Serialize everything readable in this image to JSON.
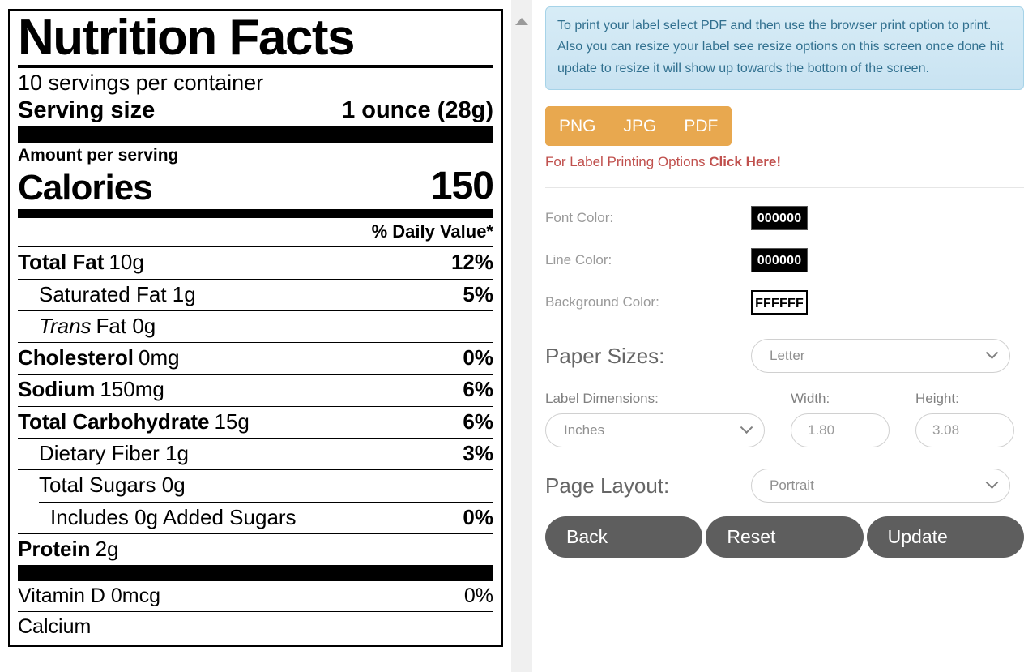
{
  "nutrition_label": {
    "title": "Nutrition Facts",
    "servings_per_container": "10 servings per container",
    "serving_size_label": "Serving size",
    "serving_size_value": "1 ounce (28g)",
    "amount_per_serving": "Amount per serving",
    "calories_label": "Calories",
    "calories_value": "150",
    "daily_value_header": "% Daily Value*",
    "rows": [
      {
        "name_bold": "Total Fat",
        "name_rest": "10g",
        "dv": "12%"
      },
      {
        "name_bold": "",
        "name_rest": "Saturated Fat 1g",
        "dv": "5%"
      },
      {
        "name_italic": "Trans",
        "name_rest": "Fat 0g",
        "dv": ""
      },
      {
        "name_bold": "Cholesterol",
        "name_rest": "0mg",
        "dv": "0%"
      },
      {
        "name_bold": "Sodium",
        "name_rest": "150mg",
        "dv": "6%"
      },
      {
        "name_bold": "Total Carbohydrate",
        "name_rest": "15g",
        "dv": "6%"
      },
      {
        "name_bold": "",
        "name_rest": "Dietary Fiber 1g",
        "dv": "3%"
      },
      {
        "name_bold": "",
        "name_rest": "Total Sugars 0g",
        "dv": ""
      },
      {
        "name_bold": "",
        "name_rest": "Includes 0g Added Sugars",
        "dv": "0%"
      },
      {
        "name_bold": "Protein",
        "name_rest": "2g",
        "dv": ""
      }
    ],
    "vitamins": [
      {
        "name": "Vitamin D  0mcg",
        "dv": "0%"
      },
      {
        "name": "Calcium",
        "dv": ""
      }
    ]
  },
  "options": {
    "info_text": "To print your label select PDF and then use the browser print option to print. Also you can resize your label see resize options on this screen once done hit update to resize it will show up towards the bottom of the screen.",
    "format_buttons": [
      {
        "label": "PNG"
      },
      {
        "label": "JPG"
      },
      {
        "label": "PDF"
      }
    ],
    "print_options_text": "For Label Printing Options ",
    "print_options_link": "Click Here!",
    "font_color_label": "Font Color:",
    "font_color_value": "000000",
    "line_color_label": "Line Color:",
    "line_color_value": "000000",
    "background_color_label": "Background Color:",
    "background_color_value": "FFFFFF",
    "paper_sizes_label": "Paper Sizes:",
    "paper_sizes_value": "Letter",
    "label_dimensions_label": "Label Dimensions:",
    "label_dimensions_value": "Inches",
    "width_label": "Width:",
    "width_value": "1.80",
    "height_label": "Height:",
    "height_value": "3.08",
    "page_layout_label": "Page Layout:",
    "page_layout_value": "Portrait",
    "back_button": "Back",
    "reset_button": "Reset",
    "update_button": "Update"
  },
  "colors": {
    "orange": "#e8a84f",
    "link_red": "#c0504d",
    "info_bg": "#cfe7f4",
    "info_text": "#31708f",
    "button_gray": "#5e5e5e"
  }
}
